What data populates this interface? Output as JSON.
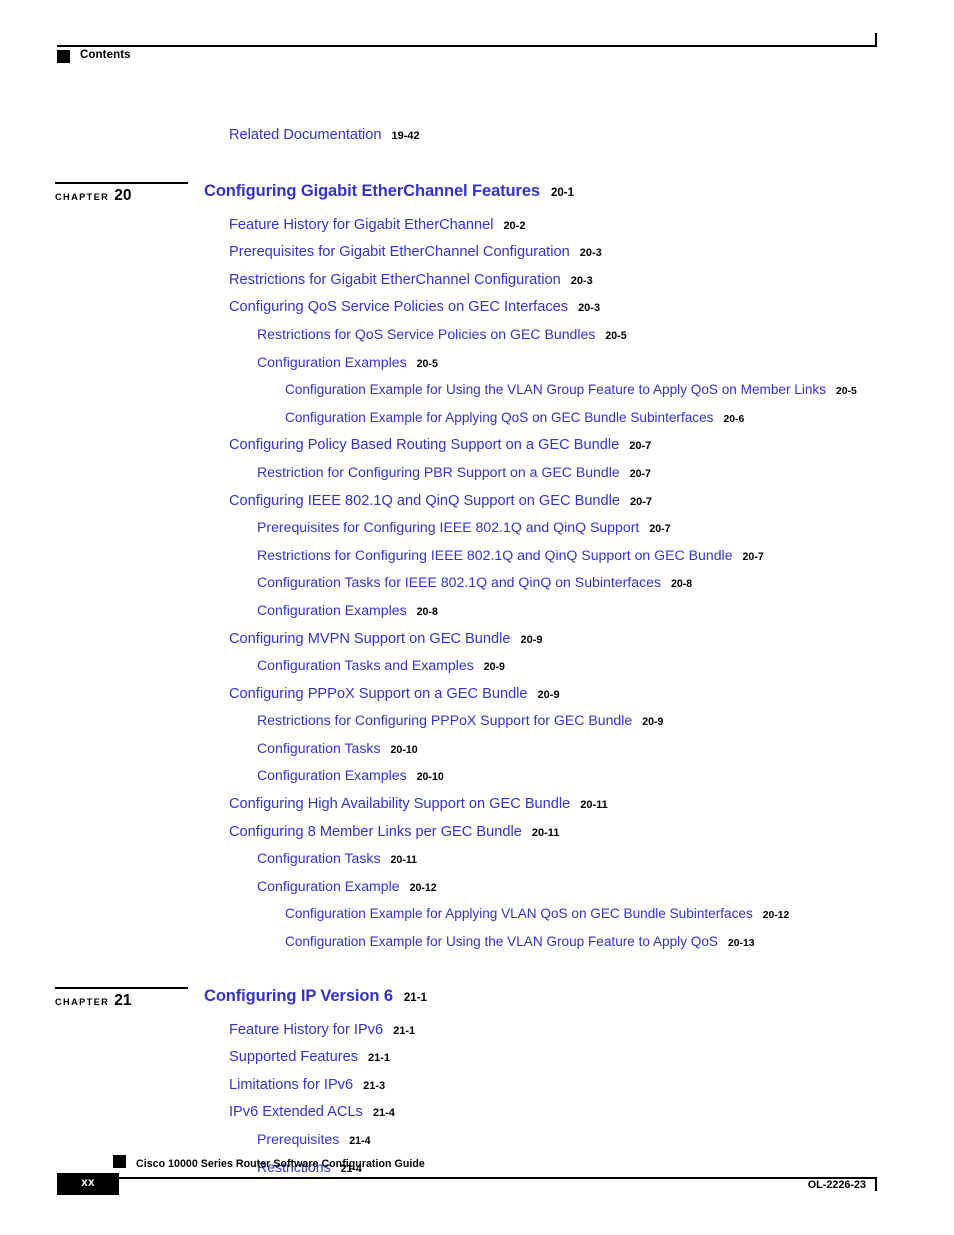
{
  "header": {
    "title": "Contents",
    "marker_icon": "square-marker-icon"
  },
  "toc": {
    "rows": [
      {
        "kind": "entry",
        "level": 1,
        "label": "Related Documentation",
        "page": "19-42"
      },
      {
        "kind": "chapter",
        "chapter_word": "CHAPTER",
        "chapter_number": "20",
        "label": "Configuring Gigabit EtherChannel Features",
        "page": "20-1"
      },
      {
        "kind": "entry",
        "level": 1,
        "label": "Feature History for Gigabit EtherChannel",
        "page": "20-2"
      },
      {
        "kind": "entry",
        "level": 1,
        "label": "Prerequisites for Gigabit EtherChannel Configuration",
        "page": "20-3"
      },
      {
        "kind": "entry",
        "level": 1,
        "label": "Restrictions for Gigabit EtherChannel Configuration",
        "page": "20-3"
      },
      {
        "kind": "entry",
        "level": 1,
        "label": "Configuring QoS Service Policies on GEC Interfaces",
        "page": "20-3"
      },
      {
        "kind": "entry",
        "level": 2,
        "label": "Restrictions for QoS Service Policies on GEC Bundles",
        "page": "20-5"
      },
      {
        "kind": "entry",
        "level": 2,
        "label": "Configuration Examples",
        "page": "20-5"
      },
      {
        "kind": "entry",
        "level": 3,
        "label": "Configuration Example for Using the VLAN Group Feature to Apply QoS on Member Links",
        "page": "20-5"
      },
      {
        "kind": "entry",
        "level": 3,
        "label": "Configuration Example for Applying QoS on GEC Bundle Subinterfaces",
        "page": "20-6"
      },
      {
        "kind": "entry",
        "level": 1,
        "label": "Configuring Policy Based Routing Support on a GEC Bundle",
        "page": "20-7"
      },
      {
        "kind": "entry",
        "level": 2,
        "label": "Restriction for Configuring PBR Support on a GEC Bundle",
        "page": "20-7"
      },
      {
        "kind": "entry",
        "level": 1,
        "label": "Configuring IEEE 802.1Q and QinQ Support on GEC Bundle",
        "page": "20-7"
      },
      {
        "kind": "entry",
        "level": 2,
        "label": "Prerequisites for Configuring IEEE 802.1Q and QinQ Support",
        "page": "20-7"
      },
      {
        "kind": "entry",
        "level": 2,
        "label": "Restrictions for Configuring IEEE 802.1Q and QinQ Support on GEC Bundle",
        "page": "20-7"
      },
      {
        "kind": "entry",
        "level": 2,
        "label": "Configuration Tasks for IEEE 802.1Q and QinQ on Subinterfaces",
        "page": "20-8"
      },
      {
        "kind": "entry",
        "level": 2,
        "label": "Configuration Examples",
        "page": "20-8"
      },
      {
        "kind": "entry",
        "level": 1,
        "label": "Configuring MVPN Support on GEC Bundle",
        "page": "20-9"
      },
      {
        "kind": "entry",
        "level": 2,
        "label": "Configuration Tasks and Examples",
        "page": "20-9"
      },
      {
        "kind": "entry",
        "level": 1,
        "label": "Configuring PPPoX Support on a GEC Bundle",
        "page": "20-9"
      },
      {
        "kind": "entry",
        "level": 2,
        "label": "Restrictions for Configuring PPPoX Support for GEC Bundle",
        "page": "20-9"
      },
      {
        "kind": "entry",
        "level": 2,
        "label": "Configuration Tasks",
        "page": "20-10"
      },
      {
        "kind": "entry",
        "level": 2,
        "label": "Configuration Examples",
        "page": "20-10"
      },
      {
        "kind": "entry",
        "level": 1,
        "label": "Configuring High Availability Support on GEC Bundle",
        "page": "20-11"
      },
      {
        "kind": "entry",
        "level": 1,
        "label": "Configuring 8 Member Links per GEC Bundle",
        "page": "20-11"
      },
      {
        "kind": "entry",
        "level": 2,
        "label": "Configuration Tasks",
        "page": "20-11"
      },
      {
        "kind": "entry",
        "level": 2,
        "label": "Configuration Example",
        "page": "20-12"
      },
      {
        "kind": "entry",
        "level": 3,
        "label": "Configuration Example for Applying VLAN QoS on GEC Bundle Subinterfaces",
        "page": "20-12"
      },
      {
        "kind": "entry",
        "level": 3,
        "label": "Configuration Example for Using the VLAN Group Feature to Apply QoS",
        "page": "20-13"
      },
      {
        "kind": "chapter",
        "chapter_word": "CHAPTER",
        "chapter_number": "21",
        "label": "Configuring IP Version 6",
        "page": "21-1"
      },
      {
        "kind": "entry",
        "level": 1,
        "label": "Feature History for IPv6",
        "page": "21-1"
      },
      {
        "kind": "entry",
        "level": 1,
        "label": "Supported Features",
        "page": "21-1"
      },
      {
        "kind": "entry",
        "level": 1,
        "label": "Limitations for IPv6",
        "page": "21-3"
      },
      {
        "kind": "entry",
        "level": 1,
        "label": "IPv6 Extended ACLs",
        "page": "21-4"
      },
      {
        "kind": "entry",
        "level": 2,
        "label": "Prerequisites",
        "page": "21-4"
      },
      {
        "kind": "entry",
        "level": 2,
        "label": "Restrictions",
        "page": "21-4"
      }
    ]
  },
  "footer": {
    "guide_title": "Cisco 10000 Series Router Software Configuration Guide",
    "page_number": "xx",
    "document_id": "OL-2226-23",
    "marker_icon": "square-marker-icon"
  },
  "colors": {
    "link_blue": "#3333cc",
    "text_black": "#000000",
    "page_background": "#ffffff"
  }
}
